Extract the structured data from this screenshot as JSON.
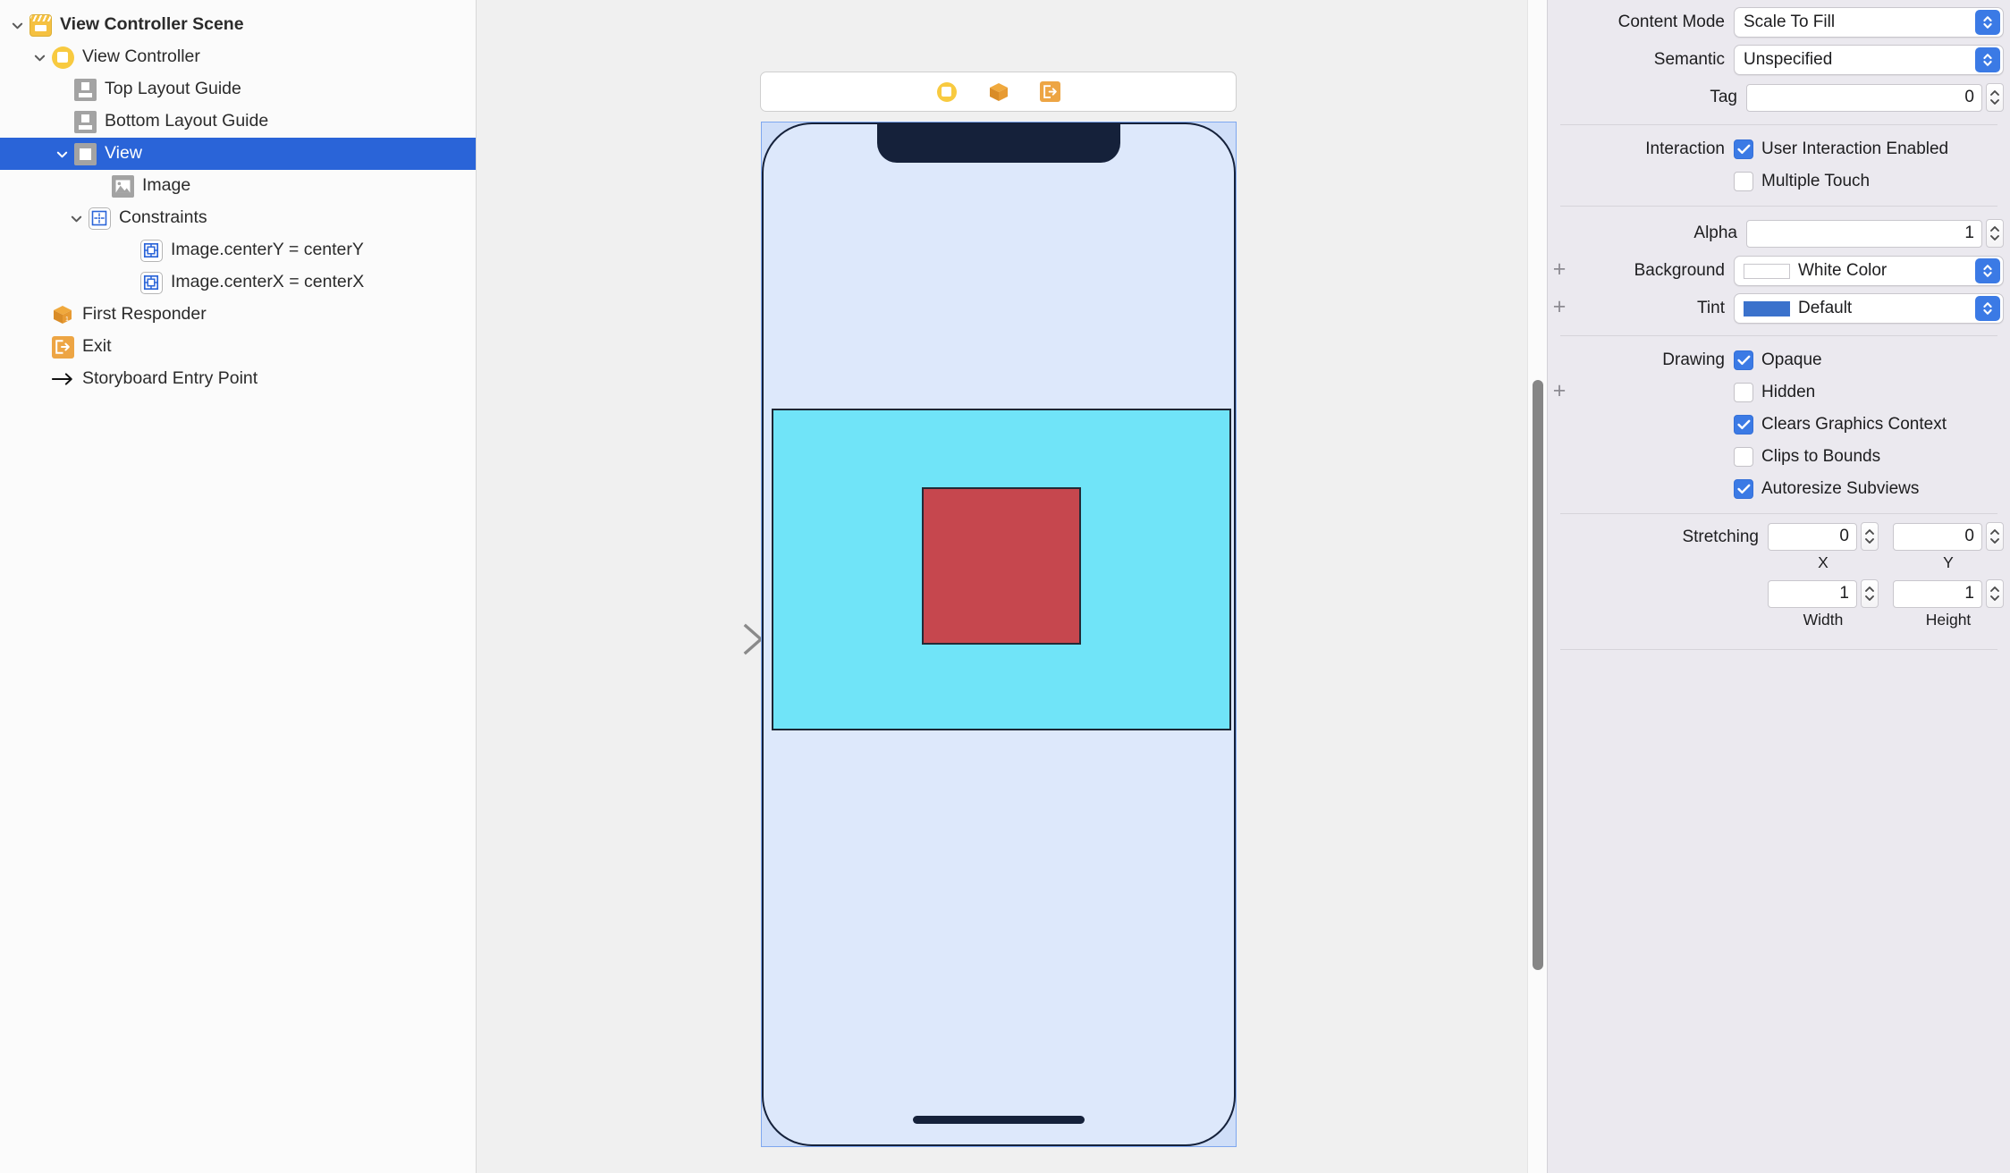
{
  "outline": {
    "items": [
      {
        "label": "View Controller Scene",
        "icon": "scene-icon",
        "indent": 0,
        "twisty": "down",
        "bold": true,
        "selected": false
      },
      {
        "label": "View Controller",
        "icon": "view-controller-icon",
        "indent": 1,
        "twisty": "down",
        "bold": false,
        "selected": false
      },
      {
        "label": "Top Layout Guide",
        "icon": "layout-guide-icon",
        "indent": 2,
        "twisty": "none",
        "bold": false,
        "selected": false
      },
      {
        "label": "Bottom Layout Guide",
        "icon": "layout-guide-icon",
        "indent": 2,
        "twisty": "none",
        "bold": false,
        "selected": false
      },
      {
        "label": "View",
        "icon": "view-icon",
        "indent": 2,
        "twisty": "down",
        "bold": false,
        "selected": true
      },
      {
        "label": "Image",
        "icon": "image-icon",
        "indent": 3,
        "twisty": "none",
        "bold": false,
        "selected": false
      },
      {
        "label": "Constraints",
        "icon": "constraints-folder-icon",
        "indent": 3,
        "twisty": "down",
        "bold": false,
        "selected": false
      },
      {
        "label": "Image.centerY = centerY",
        "icon": "constraint-icon",
        "indent": 4,
        "twisty": "none",
        "bold": false,
        "selected": false
      },
      {
        "label": "Image.centerX = centerX",
        "icon": "constraint-icon",
        "indent": 4,
        "twisty": "none",
        "bold": false,
        "selected": false
      },
      {
        "label": "First Responder",
        "icon": "first-responder-icon",
        "indent": 1,
        "twisty": "none",
        "bold": false,
        "selected": false
      },
      {
        "label": "Exit",
        "icon": "exit-icon",
        "indent": 1,
        "twisty": "none",
        "bold": false,
        "selected": false
      },
      {
        "label": "Storyboard Entry Point",
        "icon": "entry-point-arrow-icon",
        "indent": 1,
        "twisty": "none",
        "bold": false,
        "selected": false
      }
    ]
  },
  "canvas": {
    "scene_toolbar_icons": [
      "view-controller-dock-icon",
      "first-responder-dock-icon",
      "exit-dock-icon"
    ],
    "colors": {
      "view_background": "#70e4f8",
      "image_fill": "#c6474e",
      "device_background": "#dde8fb",
      "selection_blue": "#2a64d8",
      "preview_red": "#e0281c",
      "preview_cyan": "#78f0f8"
    }
  },
  "inspector": {
    "content_mode": {
      "label": "Content Mode",
      "value": "Scale To Fill"
    },
    "semantic": {
      "label": "Semantic",
      "value": "Unspecified"
    },
    "tag": {
      "label": "Tag",
      "value": "0"
    },
    "interaction": {
      "label": "Interaction",
      "options": [
        {
          "label": "User Interaction Enabled",
          "checked": true
        },
        {
          "label": "Multiple Touch",
          "checked": false
        }
      ]
    },
    "alpha": {
      "label": "Alpha",
      "value": "1"
    },
    "background": {
      "label": "Background",
      "value": "White Color",
      "swatch": "#ffffff"
    },
    "tint": {
      "label": "Tint",
      "value": "Default",
      "swatch": "#3b72cc"
    },
    "drawing": {
      "label": "Drawing",
      "options": [
        {
          "label": "Opaque",
          "checked": true
        },
        {
          "label": "Hidden",
          "checked": false
        },
        {
          "label": "Clears Graphics Context",
          "checked": true
        },
        {
          "label": "Clips to Bounds",
          "checked": false
        },
        {
          "label": "Autoresize Subviews",
          "checked": true
        }
      ]
    },
    "stretching": {
      "label": "Stretching",
      "x": {
        "caption": "X",
        "value": "0"
      },
      "y": {
        "caption": "Y",
        "value": "0"
      },
      "width": {
        "caption": "Width",
        "value": "1"
      },
      "height": {
        "caption": "Height",
        "value": "1"
      }
    }
  }
}
